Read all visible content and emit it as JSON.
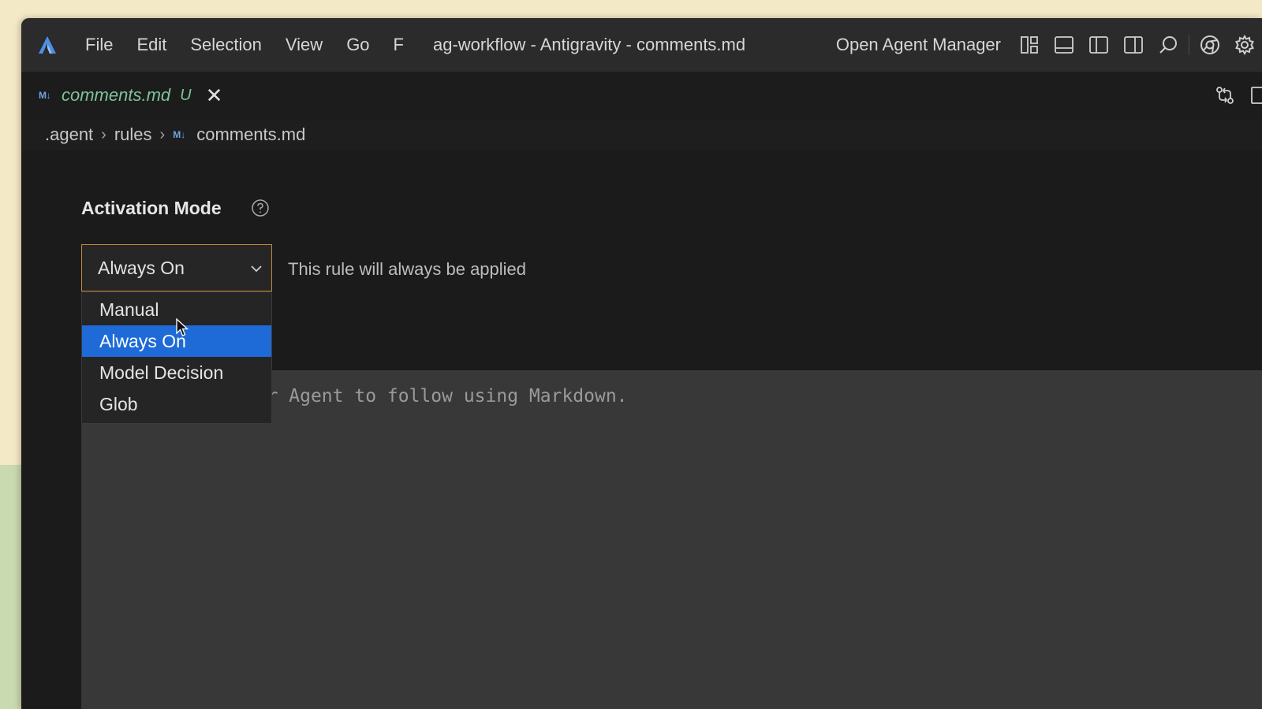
{
  "menu": [
    "File",
    "Edit",
    "Selection",
    "View",
    "Go",
    "F"
  ],
  "window_title": "ag-workflow - Antigravity - comments.md",
  "open_agent_manager": "Open Agent Manager",
  "tab": {
    "badge": "M↓",
    "name": "comments.md",
    "status": "U"
  },
  "breadcrumb": {
    "part1": ".agent",
    "part2": "rules",
    "badge": "M↓",
    "file": "comments.md"
  },
  "activation": {
    "label": "Activation Mode",
    "selected": "Always On",
    "hint": "This rule will always be applied",
    "options": [
      "Manual",
      "Always On",
      "Model Decision",
      "Glob"
    ],
    "highlighted_option": "Always On"
  },
  "editor": {
    "visible_placeholder": "ule for Agent to follow using Markdown."
  },
  "colors": {
    "accent": "#1e6ad7",
    "select_border": "#c08a3c",
    "tab_text": "#7ec49b"
  },
  "icons": [
    "antigravity-logo",
    "layout-icon",
    "panel-icon",
    "split-editor-icon",
    "secondary-sidebar-icon",
    "search-icon",
    "chrome-icon",
    "gear-icon",
    "source-control-icon",
    "split-icon"
  ]
}
